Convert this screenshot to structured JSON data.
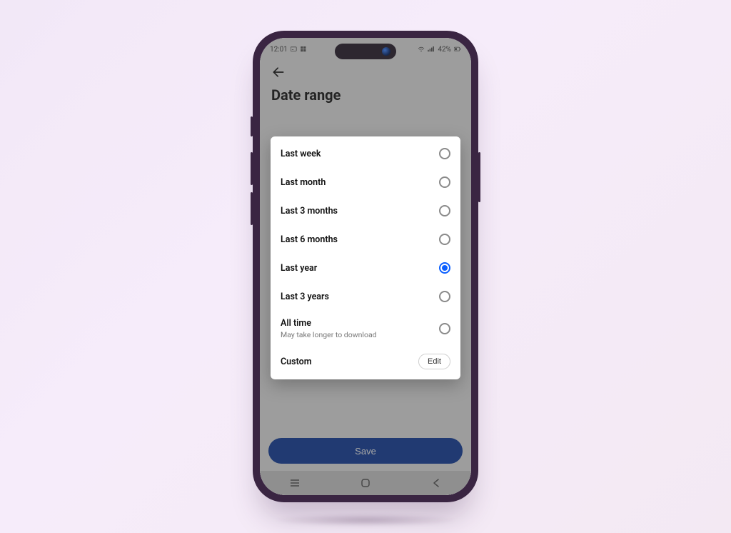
{
  "statusbar": {
    "time": "12:01",
    "battery": "42%"
  },
  "header": {
    "title": "Date range"
  },
  "options": [
    {
      "label": "Last week",
      "subtitle": "",
      "selected": false
    },
    {
      "label": "Last month",
      "subtitle": "",
      "selected": false
    },
    {
      "label": "Last 3 months",
      "subtitle": "",
      "selected": false
    },
    {
      "label": "Last 6 months",
      "subtitle": "",
      "selected": false
    },
    {
      "label": "Last year",
      "subtitle": "",
      "selected": true
    },
    {
      "label": "Last 3 years",
      "subtitle": "",
      "selected": false
    },
    {
      "label": "All time",
      "subtitle": "May take longer to download",
      "selected": false
    }
  ],
  "custom": {
    "label": "Custom",
    "edit_label": "Edit"
  },
  "actions": {
    "save_label": "Save"
  }
}
